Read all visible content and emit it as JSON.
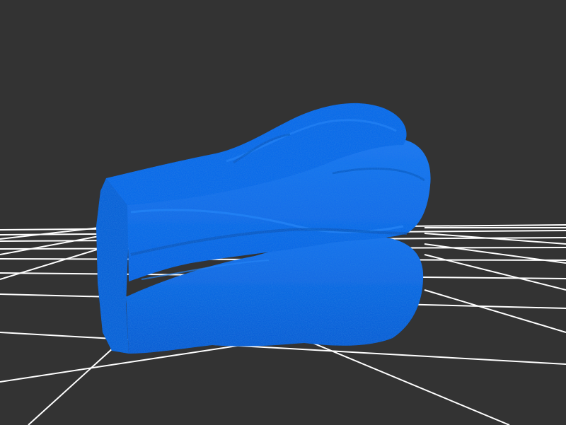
{
  "viewer": {
    "background_color": "#333333",
    "grid_color": "#ffffff",
    "grid_visible": true
  },
  "model": {
    "color": "#0a5fe6",
    "shadow_color": "#0648b8",
    "highlight_color": "#2a86ff",
    "cut_face_color": "#0a58d6"
  }
}
